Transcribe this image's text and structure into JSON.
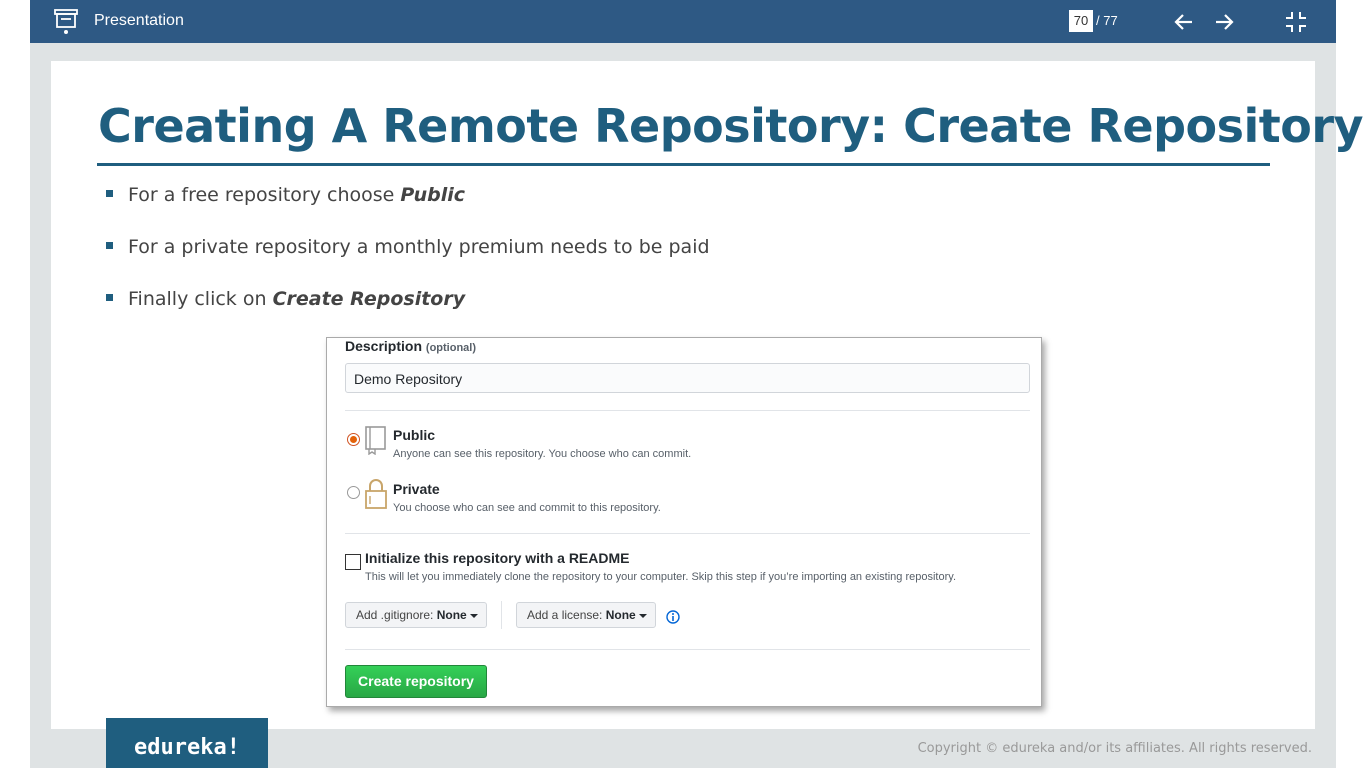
{
  "topbar": {
    "title": "Presentation",
    "current_page": "70",
    "total_pages": "/ 77",
    "icons": [
      "presentation-icon",
      "arrow-left-icon",
      "arrow-right-icon",
      "exit-fullscreen-icon"
    ]
  },
  "slide": {
    "heading": "Creating A Remote Repository: Create Repository",
    "bullets": [
      {
        "text": "For a free repository choose ",
        "emphasis": "Public"
      },
      {
        "text": "For a private repository a monthly premium needs to be paid",
        "emphasis": ""
      },
      {
        "text": "Finally click on ",
        "emphasis": "Create Repository"
      }
    ]
  },
  "github_form": {
    "description_label": "Description",
    "description_optional": "(optional)",
    "description_value": "Demo Repository",
    "public_title": "Public",
    "public_desc": "Anyone can see this repository. You choose who can commit.",
    "private_title": "Private",
    "private_desc": "You choose who can see and commit to this repository.",
    "readme_title": "Initialize this repository with a README",
    "readme_desc": "This will let you immediately clone the repository to your computer. Skip this step if you’re importing an existing repository.",
    "gitignore_label": "Add .gitignore:",
    "gitignore_value": "None",
    "license_label": "Add a license:",
    "license_value": "None",
    "create_button": "Create repository",
    "selected_visibility": "Public",
    "readme_checked": false
  },
  "footer": {
    "logo_text": "edureka!",
    "copyright": "Copyright © edureka and/or its affiliates. All rights reserved."
  },
  "colors": {
    "topbar": "#2e5984",
    "heading": "#1f5e7f",
    "create_button": "#28a745",
    "radio_selected": "#e36209"
  }
}
